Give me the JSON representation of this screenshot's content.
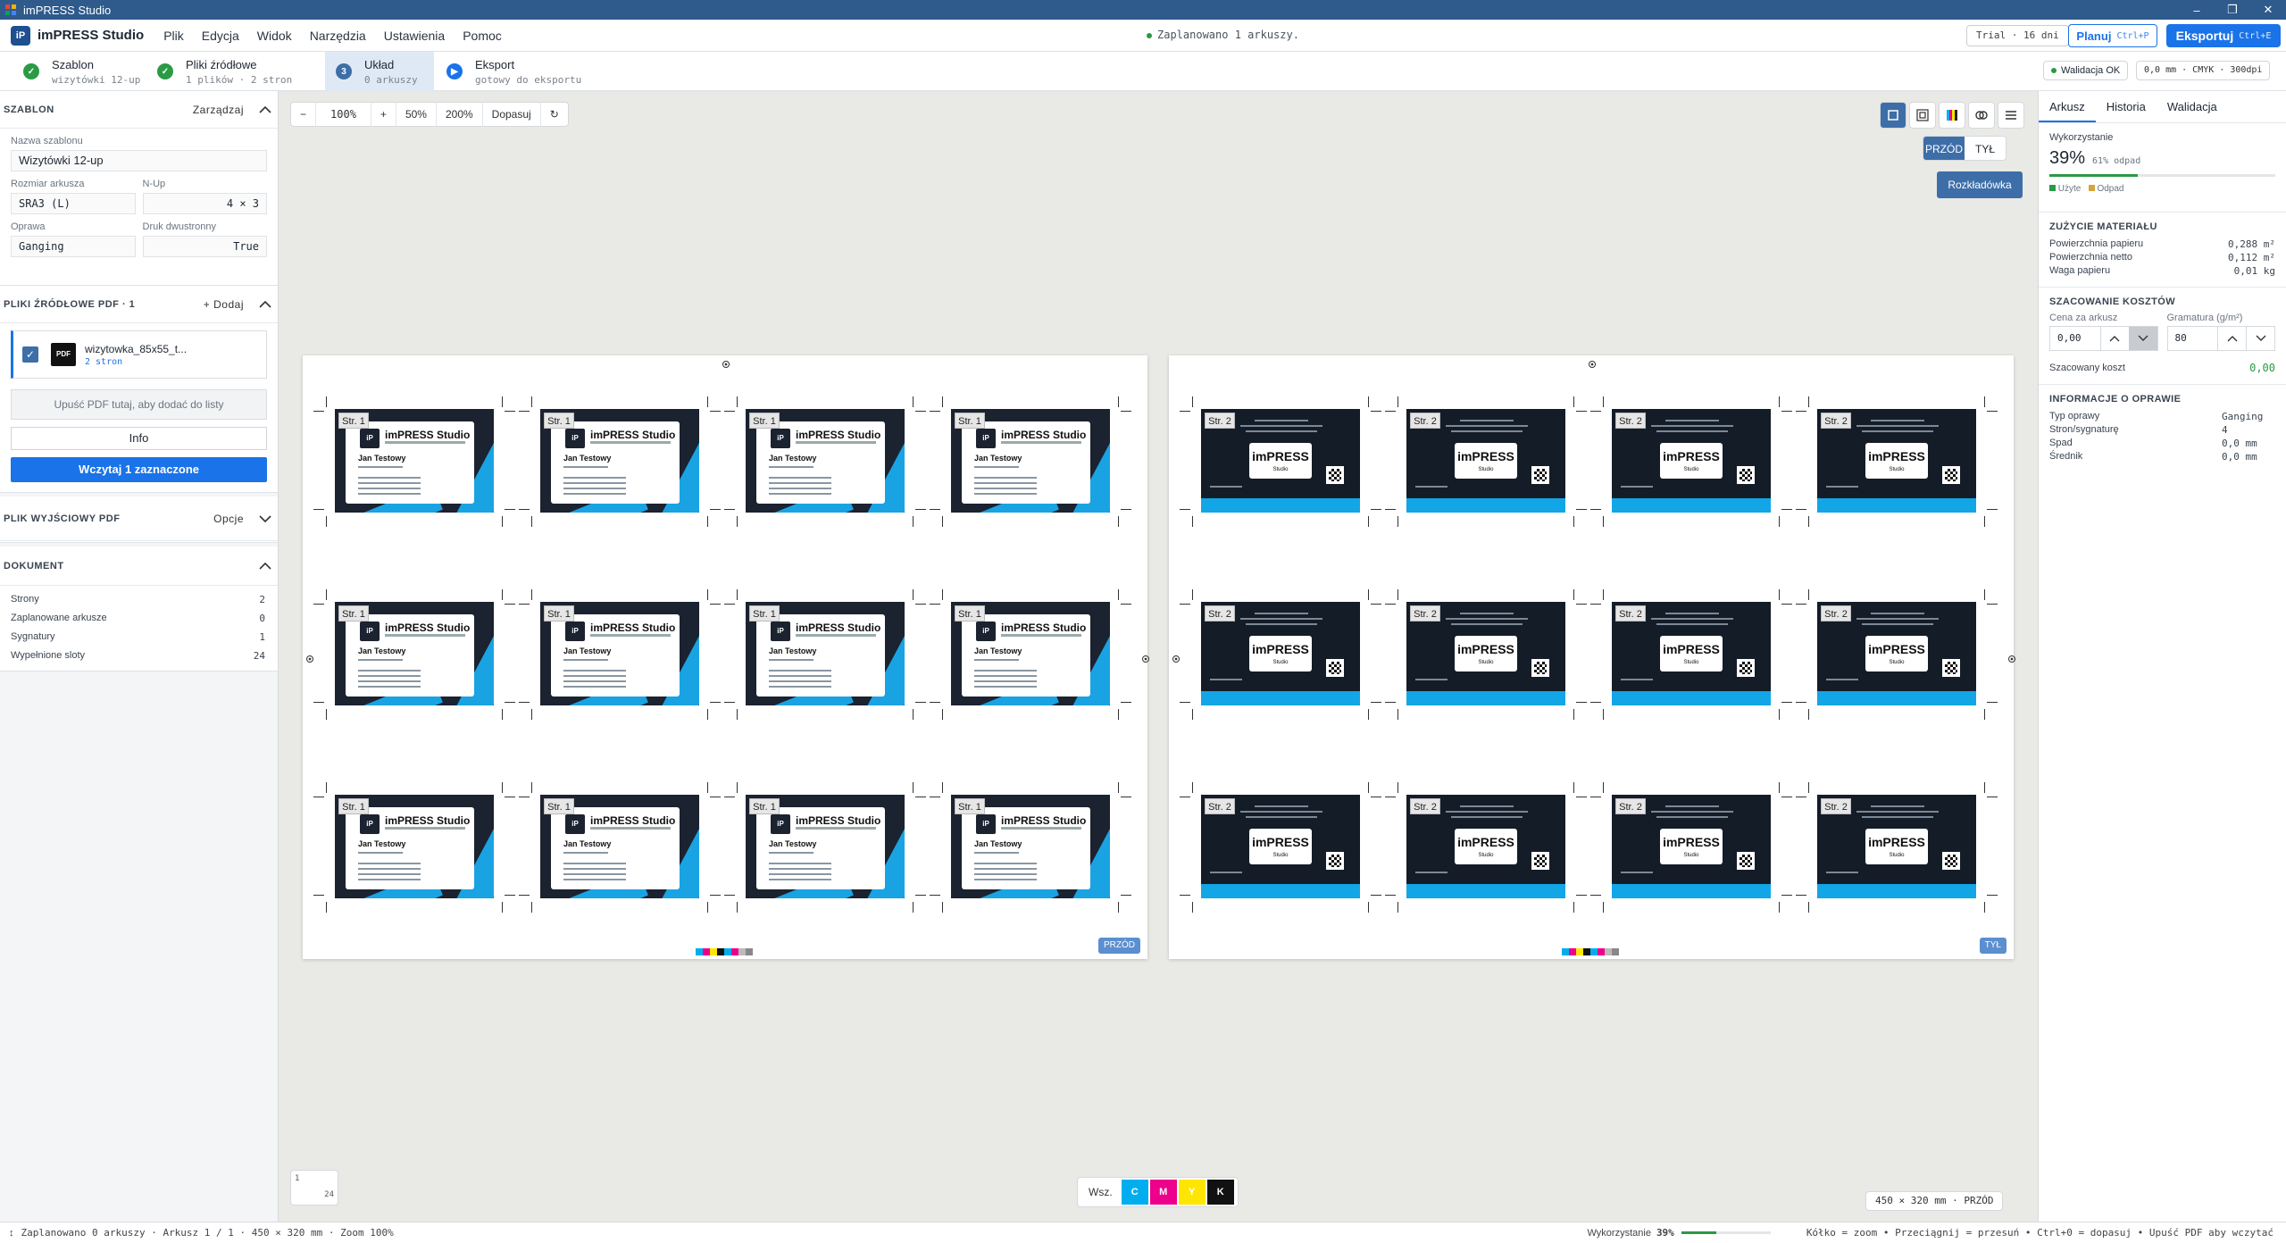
{
  "window": {
    "title": "imPRESS Studio"
  },
  "app": {
    "logo": "iP",
    "name": "imPRESS Studio"
  },
  "menu": [
    "Plik",
    "Edycja",
    "Widok",
    "Narzędzia",
    "Ustawienia",
    "Pomoc"
  ],
  "header": {
    "scheduled": "Zaplanowano 1 arkuszy.",
    "trial": "Trial · 16 dni",
    "plan_label": "Planuj",
    "plan_kbd": "Ctrl+P",
    "export_label": "Eksportuj",
    "export_kbd": "Ctrl+E"
  },
  "steps": [
    {
      "title": "Szablon",
      "sub": "wizytówki 12-up",
      "state": "done",
      "icon": "✓"
    },
    {
      "title": "Pliki źródłowe",
      "sub": "1 plików · 2 stron",
      "state": "done",
      "icon": "✓"
    },
    {
      "title": "Układ",
      "sub": "0 arkuszy",
      "state": "active",
      "icon": "3"
    },
    {
      "title": "Eksport",
      "sub": "gotowy do eksportu",
      "state": "next",
      "icon": "▶"
    }
  ],
  "validation": {
    "label": "Walidacja OK",
    "measure": "0,0 mm · CMYK · 300dpi"
  },
  "left": {
    "szablon": {
      "title": "SZABLON",
      "action": "Zarządzaj",
      "name_label": "Nazwa szablonu",
      "name_value": "Wizytówki 12-up",
      "size_label": "Rozmiar arkusza",
      "size_value": "SRA3 (L)",
      "nup_label": "N-Up",
      "nup_value": "4 × 3",
      "binding_label": "Oprawa",
      "binding_value": "Ganging",
      "duplex_label": "Druk dwustronny",
      "duplex_value": "True"
    },
    "source": {
      "title": "PLIKI ŹRÓDŁOWE PDF · 1",
      "action": "+ Dodaj",
      "file_name": "wizytowka_85x55_t...",
      "file_pages": "2 stron",
      "file_icon": "PDF",
      "drop_text": "Upuść PDF tutaj, aby dodać do listy",
      "info_label": "Info",
      "load_label": "Wczytaj 1 zaznaczone"
    },
    "output": {
      "title": "PLIK WYJŚCIOWY PDF",
      "action": "Opcje"
    },
    "document": {
      "title": "DOKUMENT",
      "rows": [
        {
          "k": "Strony",
          "v": "2"
        },
        {
          "k": "Zaplanowane arkusze",
          "v": "0"
        },
        {
          "k": "Sygnatury",
          "v": "1"
        },
        {
          "k": "Wypełnione sloty",
          "v": "24"
        }
      ]
    }
  },
  "canvas": {
    "zoom": {
      "minus": "−",
      "value": "100%",
      "plus": "+",
      "z50": "50%",
      "z200": "200%",
      "fit": "Dopasuj",
      "reset": "↻"
    },
    "side_front": "PRZÓD",
    "side_back": "TYŁ",
    "spread": "Rozkładówka",
    "front_card": {
      "page": "Str. 1",
      "logo": "iP",
      "company": "imPRESS Studio",
      "person": "Jan Testowy"
    },
    "back_card": {
      "page": "Str. 2",
      "logo": "imPRESS",
      "logo_sub": "Studio"
    },
    "sheet_badges": [
      "PRZÓD",
      "TYŁ"
    ],
    "separations": {
      "all": "Wsz.",
      "c": "C",
      "m": "M",
      "y": "Y",
      "k": "K"
    },
    "thumb": {
      "page": "1",
      "total": "24"
    },
    "dims": "450 × 320 mm · PRZÓD"
  },
  "right": {
    "tabs": [
      "Arkusz",
      "Historia",
      "Walidacja"
    ],
    "usage": {
      "title": "Wykorzystanie",
      "value": "39%",
      "waste": "61% odpad",
      "legend_used": "Użyte",
      "legend_waste": "Odpad",
      "used_fraction": 0.39
    },
    "material": {
      "title": "ZUŻYCIE MATERIAŁU",
      "rows": [
        {
          "k": "Powierzchnia papieru",
          "v": "0,288 m²"
        },
        {
          "k": "Powierzchnia netto",
          "v": "0,112 m²"
        },
        {
          "k": "Waga papieru",
          "v": "0,01 kg"
        }
      ]
    },
    "cost": {
      "title": "SZACOWANIE KOSZTÓW",
      "price_label": "Cena za arkusz",
      "price_value": "0,00",
      "gsm_label": "Gramatura (g/m²)",
      "gsm_value": "80",
      "estimate_label": "Szacowany koszt",
      "estimate_value": "0,00"
    },
    "binding": {
      "title": "INFORMACJE O OPRAWIE",
      "rows": [
        {
          "k": "Typ oprawy",
          "v": "Ganging"
        },
        {
          "k": "Stron/sygnaturę",
          "v": "4"
        },
        {
          "k": "Spad",
          "v": "0,0 mm"
        },
        {
          "k": "Średnik",
          "v": "0,0 mm"
        }
      ]
    }
  },
  "status": {
    "left": "Zaplanowano 0 arkuszy · Arkusz 1 / 1 · 450 × 320 mm · Zoom 100%",
    "usage_label": "Wykorzystanie",
    "usage_value": "39%",
    "hints": "Kółko = zoom  •  Przeciągnij = przesuń  •  Ctrl+0 = dopasuj  •  Upuść PDF aby wczytać"
  },
  "colors": {
    "accent": "#1a73e8",
    "title_bar": "#2e5a8c",
    "cyan": "#1aa3e3",
    "ok": "#2a9a45"
  }
}
